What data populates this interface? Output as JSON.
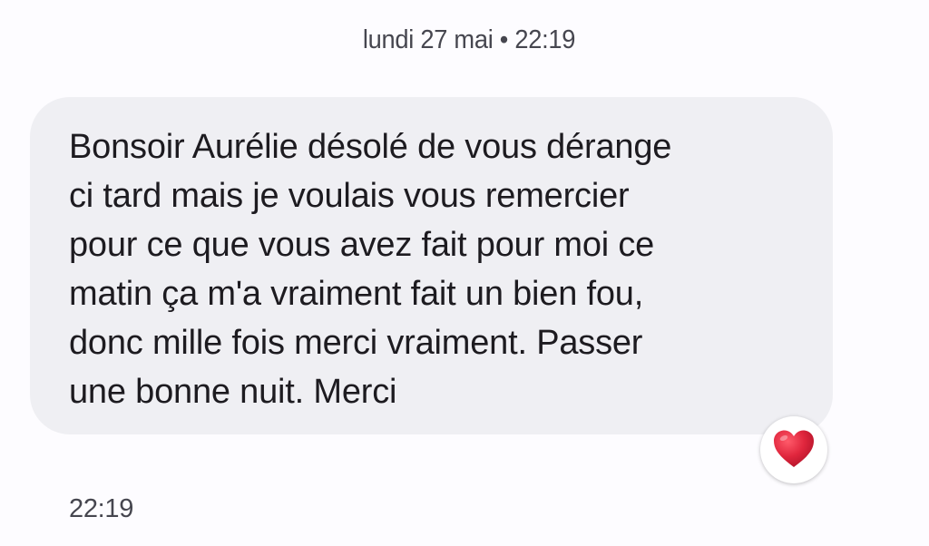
{
  "conversation": {
    "date_header": "lundi 27 mai • 22:19",
    "message": {
      "lines": [
        "Bonsoir Aurélie désolé de vous dérange",
        "ci tard mais je voulais vous remercier",
        "pour ce que vous avez fait pour moi ce",
        "matin ça m'a vraiment fait un bien fou,",
        "donc mille fois merci vraiment. Passer",
        "une bonne nuit. Merci"
      ],
      "reaction_icon": "red-heart-icon",
      "timestamp": "22:19"
    }
  },
  "colors": {
    "background": "#fdfcff",
    "bubble": "#efeff3",
    "heart": "#e0263d"
  }
}
